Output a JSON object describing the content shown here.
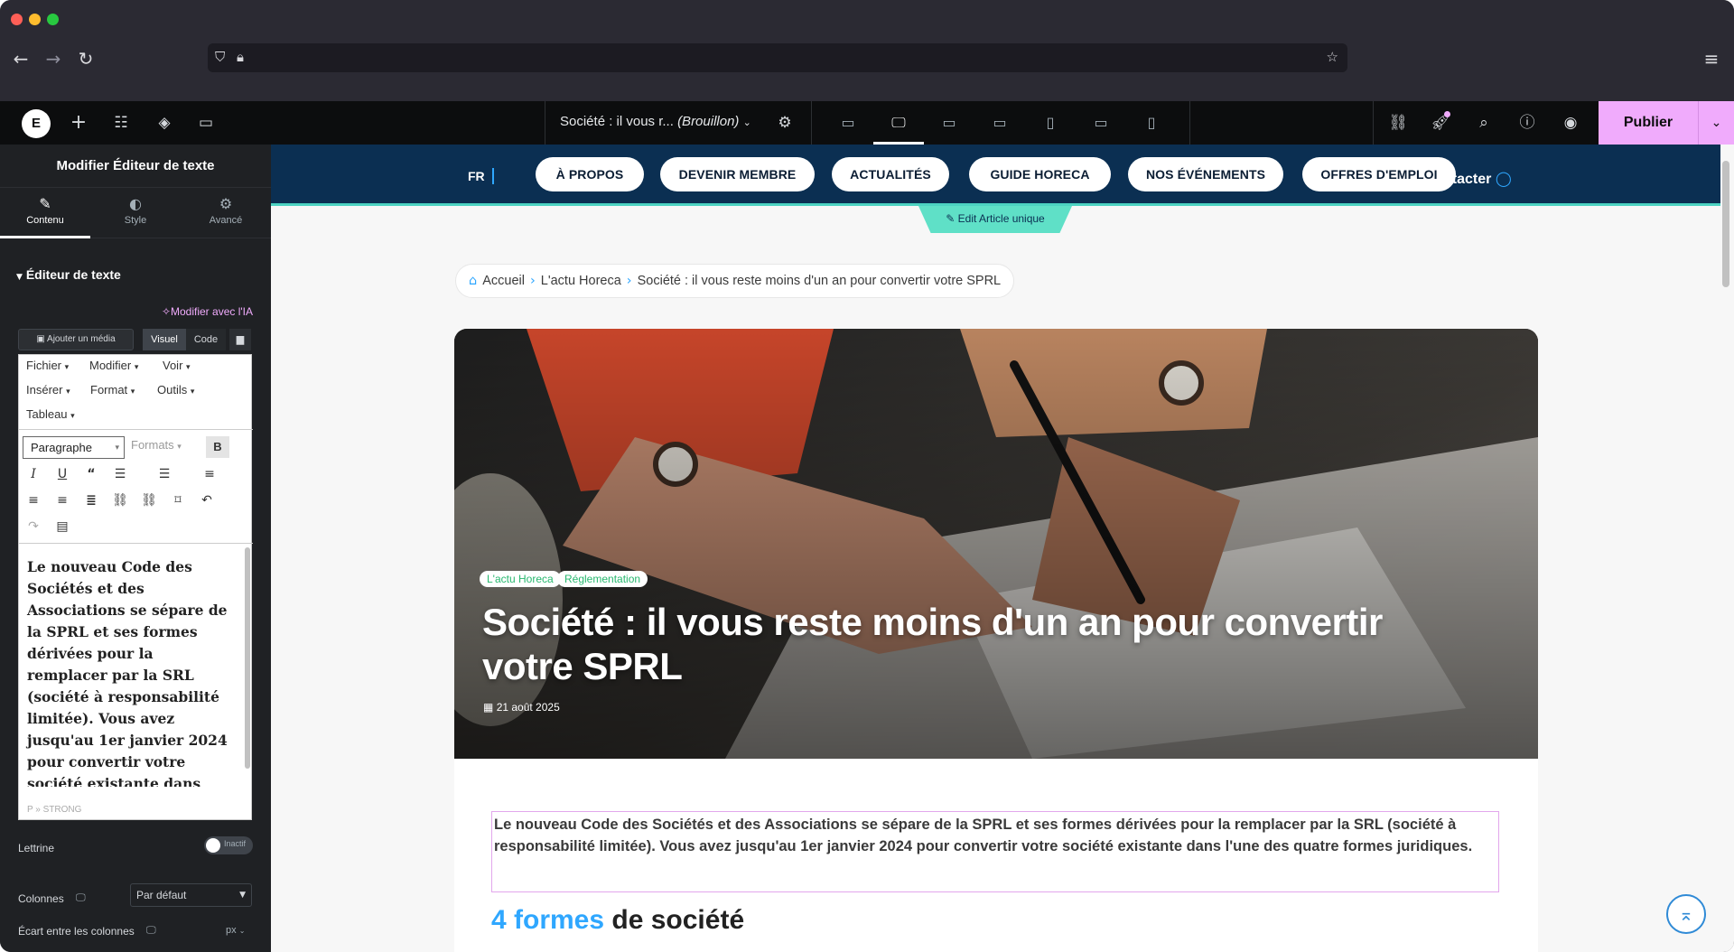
{
  "browser": {
    "icons": {
      "back": "arrow-left-icon",
      "forward": "arrow-right-icon",
      "reload": "reload-icon",
      "shield": "shield-icon",
      "lock": "lock-icon",
      "star": "star-icon",
      "menu": "hamburger-icon"
    }
  },
  "editor_bar": {
    "doc_title": "Société : il vous r...",
    "doc_status": "(Brouillon)",
    "publish_label": "Publier",
    "accent": "#f0abfc"
  },
  "panel": {
    "header": "Modifier Éditeur de texte",
    "tabs": [
      {
        "label": "Contenu",
        "icon": "pencil-icon"
      },
      {
        "label": "Style",
        "icon": "contrast-icon"
      },
      {
        "label": "Avancé",
        "icon": "gear-icon"
      }
    ],
    "section_title": "Éditeur de texte",
    "ai_link": "Modifier avec l'IA",
    "media_button": "Ajouter un média",
    "visual_tab": "Visuel",
    "code_tab": "Code",
    "menus": [
      "Fichier",
      "Modifier",
      "Voir",
      "Insérer",
      "Format",
      "Outils",
      "Tableau"
    ],
    "paragraph_select": "Paragraphe",
    "formats_select": "Formats",
    "bold_label": "B",
    "editor_text": "Le nouveau Code des Sociétés et des Associations se sépare de la SPRL et ses formes dérivées pour la remplacer par la SRL (société à responsabilité limitée). Vous avez jusqu'au 1er janvier 2024 pour convertir votre société existante dans l'une des",
    "status_path": "P » STRONG",
    "lettrine_label": "Lettrine",
    "lettrine_toggle": "Inactif",
    "colonnes_label": "Colonnes",
    "colonnes_value": "Par défaut",
    "ecart_label": "Écart entre les colonnes",
    "ecart_unit": "px"
  },
  "site": {
    "lang": "FR",
    "nav": [
      "À PROPOS",
      "DEVENIR MEMBRE",
      "ACTUALITÉS",
      "GUIDE HORECA",
      "NOS ÉVÉNEMENTS",
      "OFFRES D'EMPLOI"
    ],
    "contact": "ntacter",
    "edit_tab": "Edit Article unique",
    "breadcrumb": [
      "Accueil",
      "L'actu Horeca",
      "Société : il vous reste moins d'un an pour convertir votre SPRL"
    ],
    "tags": [
      "L'actu Horeca",
      "Réglementation"
    ],
    "title": "Société : il vous reste moins d'un an pour convertir votre SPRL",
    "date": "21 août 2025",
    "intro": "Le nouveau Code des Sociétés et des Associations se sépare de la SPRL et ses formes dérivées pour la remplacer par la SRL (société à responsabilité limitée). Vous avez jusqu'au 1er janvier 2024 pour convertir votre société existante dans l'une des quatre formes juridiques.",
    "h2_blue": "4 formes",
    "h2_rest": " de société",
    "colors": {
      "header": "#0b2f52",
      "accent_blue": "#2fa7ff",
      "tag_green": "#28b86f",
      "teal": "#5fe0c7"
    }
  }
}
